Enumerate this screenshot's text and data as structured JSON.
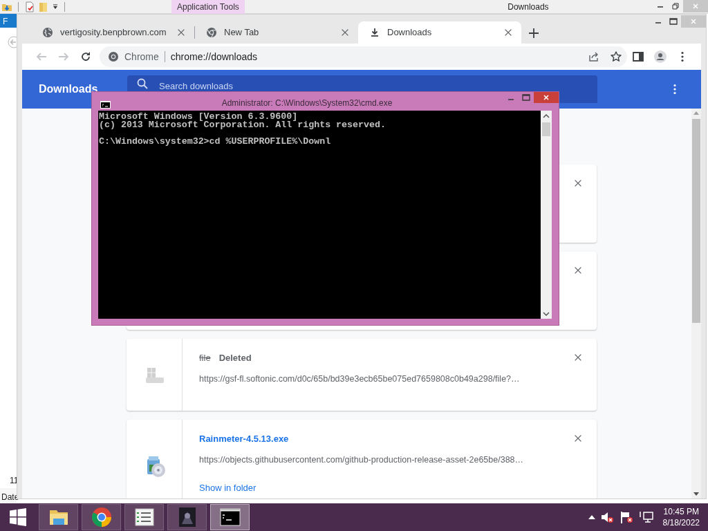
{
  "explorer": {
    "quick_access_label": "Application Tools",
    "title": "Downloads",
    "ribbon_tab": "F",
    "list_value": "11",
    "column_header": "Date"
  },
  "browser": {
    "tabs": [
      {
        "title": "vertigosity.benpbrown.com",
        "kind": "site",
        "selected": false
      },
      {
        "title": "New Tab",
        "kind": "newtab",
        "selected": false
      },
      {
        "title": "Downloads",
        "kind": "downloads",
        "selected": true
      }
    ],
    "omnibox": {
      "chip": "Chrome",
      "url": "chrome://downloads"
    }
  },
  "downloads_page": {
    "title": "Downloads",
    "search": {
      "placeholder": "Search downloads"
    },
    "items": [
      {
        "kind": "covered"
      },
      {
        "kind": "covered"
      },
      {
        "kind": "deleted",
        "file_name": "file",
        "status": "Deleted",
        "url": "https://gsf-fl.softonic.com/d0c/65b/bd39e3ecb65be075ed7659808c0b49a298/file?…"
      },
      {
        "kind": "complete",
        "file_name": "Rainmeter-4.5.13.exe",
        "url": "https://objects.githubusercontent.com/github-production-release-asset-2e65be/388…",
        "action": "Show in folder"
      }
    ]
  },
  "console": {
    "title": "Administrator: C:\\Windows\\System32\\cmd.exe",
    "blocks": [
      [
        "Microsoft Windows [Version 6.3.9600]",
        "(c) 2013 Microsoft Corporation. All rights reserved."
      ],
      [
        "C:\\Windows\\system32>cd %USERPROFILE%\\Downl"
      ]
    ]
  },
  "taskbar": {
    "apps": [
      {
        "kind": "explorer",
        "selected": false
      },
      {
        "kind": "chrome",
        "selected": false
      },
      {
        "kind": "list",
        "selected": false
      },
      {
        "kind": "game",
        "selected": false
      },
      {
        "kind": "console",
        "selected": true
      }
    ],
    "clock": {
      "time": "10:45 PM",
      "date": "8/18/2022"
    }
  }
}
